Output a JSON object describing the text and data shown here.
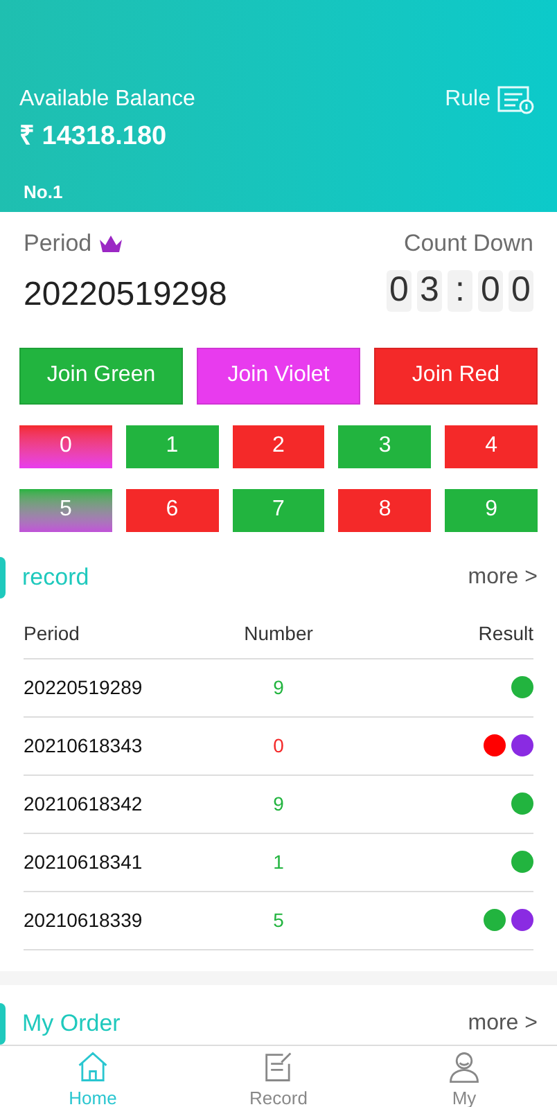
{
  "header": {
    "balance_label": "Available Balance",
    "balance": "₹ 14318.180",
    "rank": "No.1",
    "rule": "Rule"
  },
  "period": {
    "label": "Period",
    "value": "20220519298",
    "countdown_label": "Count Down",
    "countdown": [
      "0",
      "3",
      ":",
      "0",
      "0"
    ]
  },
  "join_buttons": [
    {
      "label": "Join Green",
      "color": "#22b43f"
    },
    {
      "label": "Join Violet",
      "color": "#e83bee"
    },
    {
      "label": "Join Red",
      "color": "#f42929"
    }
  ],
  "numbers": [
    {
      "label": "0",
      "kind": "red-violet"
    },
    {
      "label": "1",
      "kind": "green"
    },
    {
      "label": "2",
      "kind": "red"
    },
    {
      "label": "3",
      "kind": "green"
    },
    {
      "label": "4",
      "kind": "red"
    },
    {
      "label": "5",
      "kind": "green-violet"
    },
    {
      "label": "6",
      "kind": "red"
    },
    {
      "label": "7",
      "kind": "green"
    },
    {
      "label": "8",
      "kind": "red"
    },
    {
      "label": "9",
      "kind": "green"
    }
  ],
  "record": {
    "title": "record",
    "more": "more >",
    "columns": [
      "Period",
      "Number",
      "Result"
    ],
    "rows": [
      {
        "period": "20220519289",
        "number": "9",
        "color": "#22b43f",
        "results": [
          {
            "color": "#22b43f"
          }
        ]
      },
      {
        "period": "20210618343",
        "number": "0",
        "color": "#f42929",
        "results": [
          {
            "color": "#ff0000"
          },
          {
            "color": "#8a2be2"
          }
        ]
      },
      {
        "period": "20210618342",
        "number": "9",
        "color": "#22b43f",
        "results": [
          {
            "color": "#22b43f"
          }
        ]
      },
      {
        "period": "20210618341",
        "number": "1",
        "color": "#22b43f",
        "results": [
          {
            "color": "#22b43f"
          }
        ]
      },
      {
        "period": "20210618339",
        "number": "5",
        "color": "#22b43f",
        "results": [
          {
            "color": "#22b43f"
          },
          {
            "color": "#8a2be2"
          }
        ]
      }
    ]
  },
  "order": {
    "title": "My Order",
    "more": "more >"
  },
  "nav": [
    {
      "label": "Home",
      "kind": "home",
      "selected": true
    },
    {
      "label": "Record",
      "kind": "record",
      "selected": false
    },
    {
      "label": "My",
      "kind": "user",
      "selected": false
    }
  ]
}
